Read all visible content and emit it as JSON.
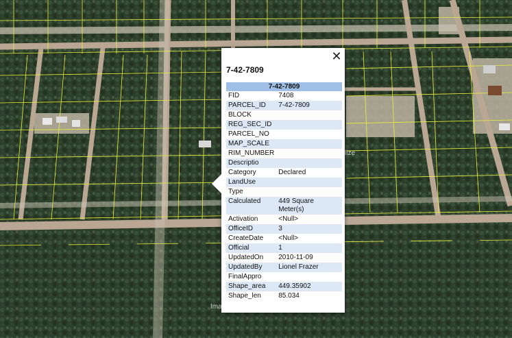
{
  "popup": {
    "title": "7-42-7809",
    "table_header": "7-42-7809",
    "close_symbol": "✕",
    "rows": [
      {
        "key": "FID",
        "value": "7408"
      },
      {
        "key": "PARCEL_ID",
        "value": "7-42-7809"
      },
      {
        "key": "BLOCK",
        "value": ""
      },
      {
        "key": "REG_SEC_ID",
        "value": ""
      },
      {
        "key": "PARCEL_NO",
        "value": ""
      },
      {
        "key": "MAP_SCALE",
        "value": ""
      },
      {
        "key": "RIM_NUMBER",
        "value": ""
      },
      {
        "key": "Descriptio",
        "value": ""
      },
      {
        "key": "Category",
        "value": "Declared"
      },
      {
        "key": "LandUse",
        "value": ""
      },
      {
        "key": "Type",
        "value": ""
      },
      {
        "key": "Calculated",
        "value": "449 Square Meter(s)"
      },
      {
        "key": "Activation",
        "value": "<Null>"
      },
      {
        "key": "OfficeID",
        "value": "3"
      },
      {
        "key": "CreateDate",
        "value": "<Null>"
      },
      {
        "key": "Official",
        "value": "1"
      },
      {
        "key": "UpdatedOn",
        "value": "2010-11-09"
      },
      {
        "key": "UpdatedBy",
        "value": "Lionel Frazer"
      },
      {
        "key": "FinalAppro",
        "value": ""
      },
      {
        "key": "Shape_area",
        "value": "449.35902"
      },
      {
        "key": "Shape_len",
        "value": "85.034"
      }
    ]
  },
  "map": {
    "watermark_left": "Ima",
    "watermark_right": "lize"
  },
  "colors": {
    "vegetation": "#2b3d2b",
    "road": "#b9a794",
    "parcel_line": "#e8f03c",
    "header": "#9fbfe6",
    "row_alt": "#dce8f6"
  }
}
